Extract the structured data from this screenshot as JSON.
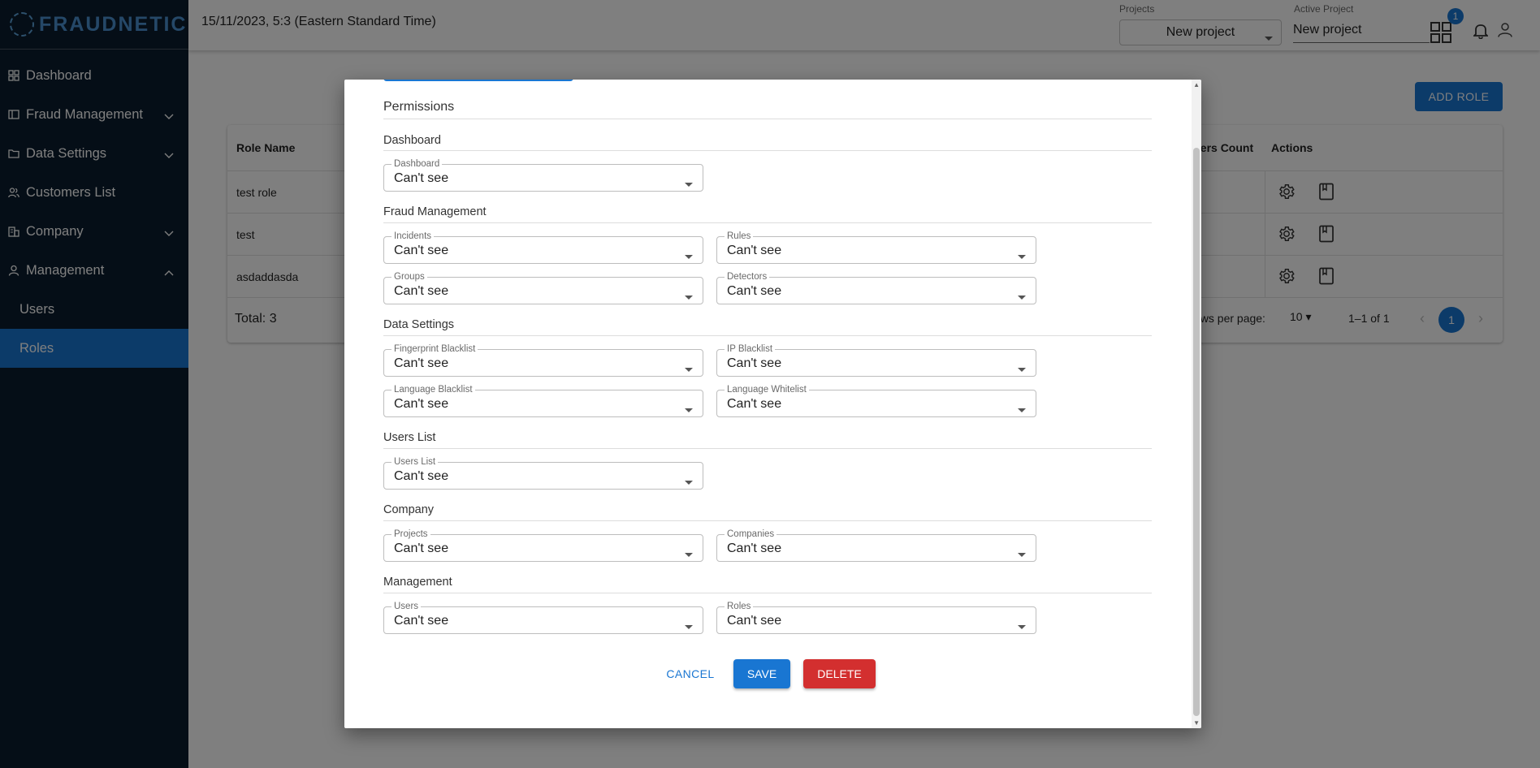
{
  "sidebar": {
    "brand": "FRAUDNETIC",
    "items": [
      {
        "label": "Dashboard"
      },
      {
        "label": "Fraud Management"
      },
      {
        "label": "Data Settings"
      },
      {
        "label": "Customers List"
      },
      {
        "label": "Company"
      },
      {
        "label": "Management"
      },
      {
        "label": "Users"
      },
      {
        "label": "Roles"
      }
    ]
  },
  "topbar": {
    "datetime": "15/11/2023, 5:3 (Eastern Standard Time)",
    "projects_label": "Projects",
    "projects_value": "New project",
    "active_project_label": "Active Project",
    "active_project_value": "New project",
    "notification_count": "1"
  },
  "main": {
    "add_role_label": "ADD ROLE",
    "table": {
      "columns": [
        "Role Name",
        "sers Count",
        "Actions"
      ],
      "rows": [
        {
          "name": "test role"
        },
        {
          "name": "test"
        },
        {
          "name": "asdaddasda"
        }
      ],
      "total": "Total: 3",
      "rows_per_page_label": "ows per page:",
      "rows_per_page_value": "10",
      "range": "1–1 of 1",
      "current_page": "1"
    }
  },
  "modal": {
    "permissions_title": "Permissions",
    "sections": [
      {
        "title": "Dashboard",
        "fields": [
          {
            "label": "Dashboard",
            "value": "Can't see"
          }
        ]
      },
      {
        "title": "Fraud Management",
        "fields": [
          {
            "label": "Incidents",
            "value": "Can't see"
          },
          {
            "label": "Rules",
            "value": "Can't see"
          },
          {
            "label": "Groups",
            "value": "Can't see"
          },
          {
            "label": "Detectors",
            "value": "Can't see"
          }
        ]
      },
      {
        "title": "Data Settings",
        "fields": [
          {
            "label": "Fingerprint Blacklist",
            "value": "Can't see"
          },
          {
            "label": "IP Blacklist",
            "value": "Can't see"
          },
          {
            "label": "Language Blacklist",
            "value": "Can't see"
          },
          {
            "label": "Language Whitelist",
            "value": "Can't see"
          }
        ]
      },
      {
        "title": "Users List",
        "fields": [
          {
            "label": "Users List",
            "value": "Can't see"
          }
        ]
      },
      {
        "title": "Company",
        "fields": [
          {
            "label": "Projects",
            "value": "Can't see"
          },
          {
            "label": "Companies",
            "value": "Can't see"
          }
        ]
      },
      {
        "title": "Management",
        "fields": [
          {
            "label": "Users",
            "value": "Can't see"
          },
          {
            "label": "Roles",
            "value": "Can't see"
          }
        ]
      }
    ],
    "cancel_label": "CANCEL",
    "save_label": "SAVE",
    "delete_label": "DELETE"
  },
  "colors": {
    "sidebar_bg": "#0b1d2e",
    "accent": "#1976d2",
    "danger": "#d32f2f"
  }
}
